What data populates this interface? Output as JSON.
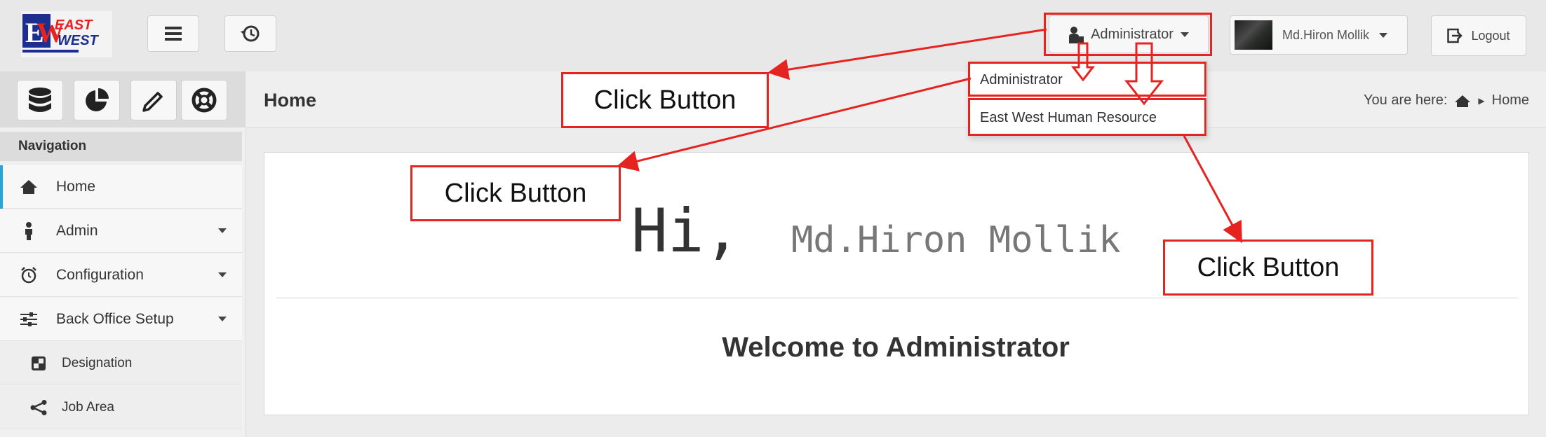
{
  "topbar": {
    "logo_text": "EAST WEST",
    "menu_button": "hamburger-icon",
    "history_button": "history-icon",
    "role_label": "Administrator",
    "user_name": "Md.Hiron Mollik",
    "logout_label": "Logout"
  },
  "role_dropdown": {
    "items": [
      "Administrator",
      "East West Human Resource"
    ]
  },
  "header": {
    "page_title": "Home",
    "breadcrumb_prefix": "You are here:",
    "breadcrumb_current": "Home"
  },
  "sidebar": {
    "tools": [
      "database-icon",
      "pie-chart-icon",
      "pencil-icon",
      "lifebuoy-icon"
    ],
    "heading": "Navigation",
    "items": [
      {
        "label": "Home",
        "icon": "home-icon",
        "active": true
      },
      {
        "label": "Admin",
        "icon": "person-icon"
      },
      {
        "label": "Configuration",
        "icon": "alarm-clock-icon"
      },
      {
        "label": "Back Office Setup",
        "icon": "sliders-icon"
      },
      {
        "label": "Designation",
        "icon": "tiles-icon",
        "sub": true
      },
      {
        "label": "Job Area",
        "icon": "share-icon",
        "sub": true
      }
    ]
  },
  "main": {
    "greeting": "Hi,",
    "greeting_name": "Md.Hiron Mollik",
    "welcome": "Welcome to Administrator"
  },
  "annotations": {
    "callout_1": "Click Button",
    "callout_2": "Click Button",
    "callout_3": "Click Button",
    "color": "#e52321"
  }
}
